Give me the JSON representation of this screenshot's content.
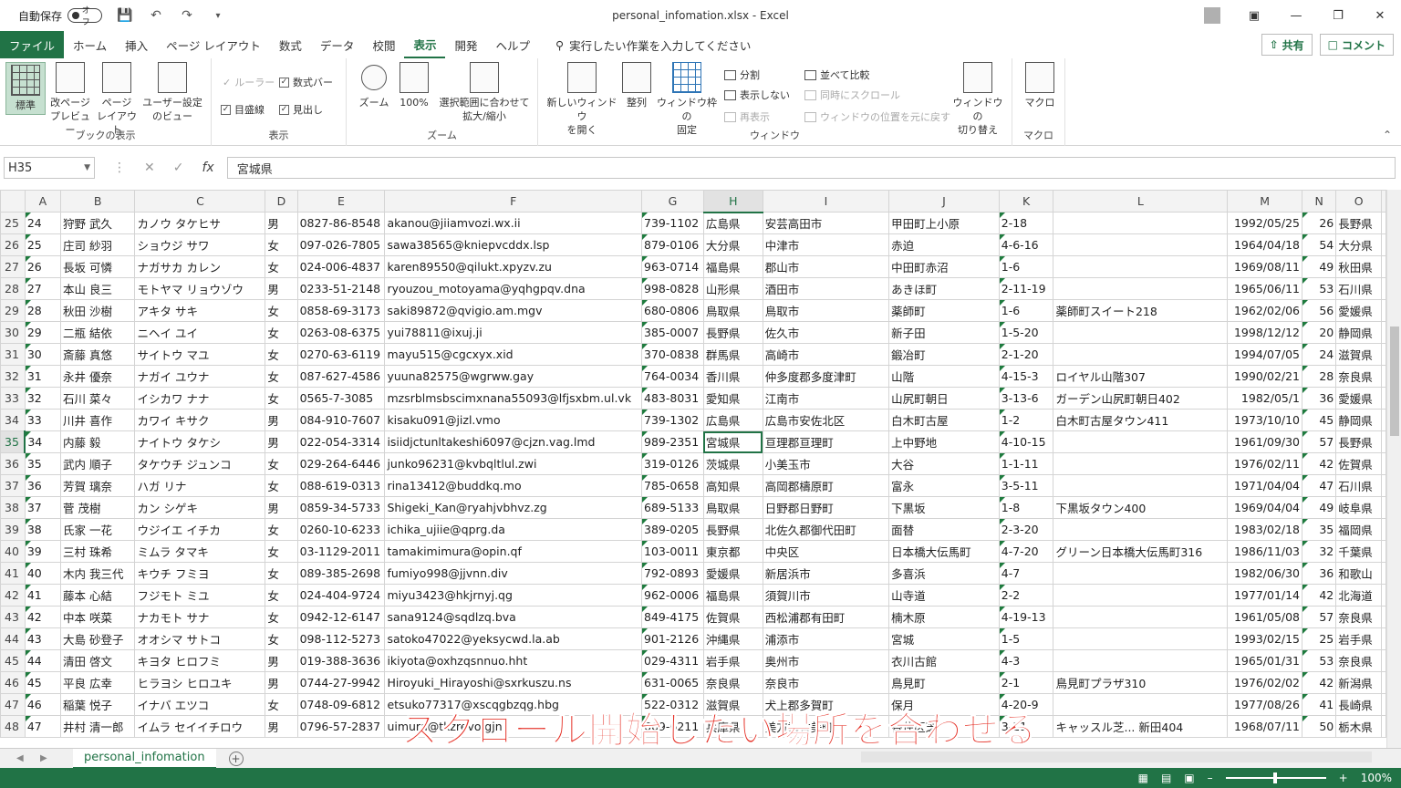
{
  "title_bar": {
    "autosave_label": "自動保存",
    "autosave_state": "オフ",
    "document_title": "personal_infomation.xlsx  -  Excel"
  },
  "menu": {
    "file": "ファイル",
    "tabs": [
      "ホーム",
      "挿入",
      "ページ レイアウト",
      "数式",
      "データ",
      "校閲",
      "表示",
      "開発",
      "ヘルプ"
    ],
    "active_tab": "表示",
    "tell_me": "実行したい作業を入力してください",
    "share": "共有",
    "comment": "コメント"
  },
  "ribbon": {
    "workbook_views": {
      "label": "ブックの表示",
      "normal": "標準",
      "page_break": "改ページ\nプレビュー",
      "page_layout": "ページ\nレイアウト",
      "custom": "ユーザー設定\nのビュー"
    },
    "show": {
      "label": "表示",
      "ruler": "ルーラー",
      "formula_bar": "数式バー",
      "gridlines": "目盛線",
      "headings": "見出し"
    },
    "zoom": {
      "label": "ズーム",
      "zoom": "ズーム",
      "hundred": "100%",
      "fit": "選択範囲に合わせて\n拡大/縮小"
    },
    "window": {
      "label": "ウィンドウ",
      "new_window": "新しいウィンドウ\nを開く",
      "arrange": "整列",
      "freeze": "ウィンドウ枠の\n固定",
      "split": "分割",
      "hide": "表示しない",
      "unhide": "再表示",
      "side_by_side": "並べて比較",
      "sync_scroll": "同時にスクロール",
      "reset_pos": "ウィンドウの位置を元に戻す",
      "switch": "ウィンドウの\n切り替え"
    },
    "macro": {
      "label": "マクロ",
      "macro": "マクロ"
    }
  },
  "formula_bar": {
    "name_box": "H35",
    "fx": "fx",
    "content": "宮城県"
  },
  "columns": [
    "A",
    "B",
    "C",
    "D",
    "E",
    "F",
    "G",
    "H",
    "I",
    "J",
    "K",
    "L",
    "M",
    "N",
    "O"
  ],
  "active_column": "H",
  "active_row": "35",
  "rows": [
    {
      "r": "25",
      "c": [
        "24",
        "狩野 武久",
        "カノウ タケヒサ",
        "男",
        "0827-86-8548",
        "akanou@jiiamvozi.wx.ii",
        "739-1102",
        "広島県",
        "安芸高田市",
        "甲田町上小原",
        "2-18",
        "",
        "1992/05/25",
        "26",
        "長野県"
      ]
    },
    {
      "r": "26",
      "c": [
        "25",
        "庄司 紗羽",
        "ショウジ サワ",
        "女",
        "097-026-7805",
        "sawa38565@kniepvcddx.lsp",
        "879-0106",
        "大分県",
        "中津市",
        "赤迫",
        "4-6-16",
        "",
        "1964/04/18",
        "54",
        "大分県"
      ]
    },
    {
      "r": "27",
      "c": [
        "26",
        "長坂 可憐",
        "ナガサカ カレン",
        "女",
        "024-006-4837",
        "karen89550@qilukt.xpyzv.zu",
        "963-0714",
        "福島県",
        "郡山市",
        "中田町赤沼",
        "1-6",
        "",
        "1969/08/11",
        "49",
        "秋田県"
      ]
    },
    {
      "r": "28",
      "c": [
        "27",
        "本山 良三",
        "モトヤマ リョウゾウ",
        "男",
        "0233-51-2148",
        "ryouzou_motoyama@yqhgpqv.dna",
        "998-0828",
        "山形県",
        "酒田市",
        "あきほ町",
        "2-11-19",
        "",
        "1965/06/11",
        "53",
        "石川県"
      ]
    },
    {
      "r": "29",
      "c": [
        "28",
        "秋田 沙樹",
        "アキタ サキ",
        "女",
        "0858-69-3173",
        "saki89872@qvigio.am.mgv",
        "680-0806",
        "鳥取県",
        "鳥取市",
        "薬師町",
        "1-6",
        "薬師町スイート218",
        "1962/02/06",
        "56",
        "愛媛県"
      ]
    },
    {
      "r": "30",
      "c": [
        "29",
        "二瓶 結依",
        "ニヘイ ユイ",
        "女",
        "0263-08-6375",
        "yui78811@ixuj.ji",
        "385-0007",
        "長野県",
        "佐久市",
        "新子田",
        "1-5-20",
        "",
        "1998/12/12",
        "20",
        "静岡県"
      ]
    },
    {
      "r": "31",
      "c": [
        "30",
        "斎藤 真悠",
        "サイトウ マユ",
        "女",
        "0270-63-6119",
        "mayu515@cgcxyx.xid",
        "370-0838",
        "群馬県",
        "高崎市",
        "鍛冶町",
        "2-1-20",
        "",
        "1994/07/05",
        "24",
        "滋賀県"
      ]
    },
    {
      "r": "32",
      "c": [
        "31",
        "永井 優奈",
        "ナガイ ユウナ",
        "女",
        "087-627-4586",
        "yuuna82575@wgrww.gay",
        "764-0034",
        "香川県",
        "仲多度郡多度津町",
        "山階",
        "4-15-3",
        "ロイヤル山階307",
        "1990/02/21",
        "28",
        "奈良県"
      ]
    },
    {
      "r": "33",
      "c": [
        "32",
        "石川 菜々",
        "イシカワ ナナ",
        "女",
        "0565-7-3085",
        "mzsrblmsbscimxnana55093@lfjsxbm.ul.vk",
        "483-8031",
        "愛知県",
        "江南市",
        "山尻町朝日",
        "3-13-6",
        "ガーデン山尻町朝日402",
        "1982/05/1",
        "36",
        "愛媛県"
      ]
    },
    {
      "r": "34",
      "c": [
        "33",
        "川井 喜作",
        "カワイ キサク",
        "男",
        "084-910-7607",
        "kisaku091@jizl.vmo",
        "739-1302",
        "広島県",
        "広島市安佐北区",
        "白木町古屋",
        "1-2",
        "白木町古屋タウン411",
        "1973/10/10",
        "45",
        "静岡県"
      ]
    },
    {
      "r": "35",
      "c": [
        "34",
        "内藤 毅",
        "ナイトウ タケシ",
        "男",
        "022-054-3314",
        "isiidjctunltakeshi6097@cjzn.vag.lmd",
        "989-2351",
        "宮城県",
        "亘理郡亘理町",
        "上中野地",
        "4-10-15",
        "",
        "1961/09/30",
        "57",
        "長野県"
      ]
    },
    {
      "r": "36",
      "c": [
        "35",
        "武内 順子",
        "タケウチ ジュンコ",
        "女",
        "029-264-6446",
        "junko96231@kvbqltlul.zwi",
        "319-0126",
        "茨城県",
        "小美玉市",
        "大谷",
        "1-1-11",
        "",
        "1976/02/11",
        "42",
        "佐賀県"
      ]
    },
    {
      "r": "37",
      "c": [
        "36",
        "芳賀 璃奈",
        "ハガ リナ",
        "女",
        "088-619-0313",
        "rina13412@buddkq.mo",
        "785-0658",
        "高知県",
        "高岡郡檮原町",
        "富永",
        "3-5-11",
        "",
        "1971/04/04",
        "47",
        "石川県"
      ]
    },
    {
      "r": "38",
      "c": [
        "37",
        "菅 茂樹",
        "カン シゲキ",
        "男",
        "0859-34-5733",
        "Shigeki_Kan@ryahjvbhvz.zg",
        "689-5133",
        "鳥取県",
        "日野郡日野町",
        "下黒坂",
        "1-8",
        "下黒坂タウン400",
        "1969/04/04",
        "49",
        "岐阜県"
      ]
    },
    {
      "r": "39",
      "c": [
        "38",
        "氏家 一花",
        "ウジイエ イチカ",
        "女",
        "0260-10-6233",
        "ichika_ujiie@qprg.da",
        "389-0205",
        "長野県",
        "北佐久郡御代田町",
        "面替",
        "2-3-20",
        "",
        "1983/02/18",
        "35",
        "福岡県"
      ]
    },
    {
      "r": "40",
      "c": [
        "39",
        "三村 珠希",
        "ミムラ タマキ",
        "女",
        "03-1129-2011",
        "tamakimimura@opin.qf",
        "103-0011",
        "東京都",
        "中央区",
        "日本橋大伝馬町",
        "4-7-20",
        "グリーン日本橋大伝馬町316",
        "1986/11/03",
        "32",
        "千葉県"
      ]
    },
    {
      "r": "41",
      "c": [
        "40",
        "木内 我三代",
        "キウチ フミヨ",
        "女",
        "089-385-2698",
        "fumiyo998@jjvnn.div",
        "792-0893",
        "愛媛県",
        "新居浜市",
        "多喜浜",
        "4-7",
        "",
        "1982/06/30",
        "36",
        "和歌山"
      ]
    },
    {
      "r": "42",
      "c": [
        "41",
        "藤本 心結",
        "フジモト ミユ",
        "女",
        "024-404-9724",
        "miyu3423@hkjrnyj.qg",
        "962-0006",
        "福島県",
        "須賀川市",
        "山寺道",
        "2-2",
        "",
        "1977/01/14",
        "42",
        "北海道"
      ]
    },
    {
      "r": "43",
      "c": [
        "42",
        "中本 咲菜",
        "ナカモト サナ",
        "女",
        "0942-12-6147",
        "sana9124@sqdlzq.bva",
        "849-4175",
        "佐賀県",
        "西松浦郡有田町",
        "楠木原",
        "4-19-13",
        "",
        "1961/05/08",
        "57",
        "奈良県"
      ]
    },
    {
      "r": "44",
      "c": [
        "43",
        "大島 砂登子",
        "オオシマ サトコ",
        "女",
        "098-112-5273",
        "satoko47022@yeksycwd.la.ab",
        "901-2126",
        "沖縄県",
        "浦添市",
        "宮城",
        "1-5",
        "",
        "1993/02/15",
        "25",
        "岩手県"
      ]
    },
    {
      "r": "45",
      "c": [
        "44",
        "清田 啓文",
        "キヨタ ヒロフミ",
        "男",
        "019-388-3636",
        "ikiyota@oxhzqsnnuo.hht",
        "029-4311",
        "岩手県",
        "奥州市",
        "衣川古館",
        "4-3",
        "",
        "1965/01/31",
        "53",
        "奈良県"
      ]
    },
    {
      "r": "46",
      "c": [
        "45",
        "平良 広幸",
        "ヒラヨシ ヒロユキ",
        "男",
        "0744-27-9942",
        "Hiroyuki_Hirayoshi@sxrkuszu.ns",
        "631-0065",
        "奈良県",
        "奈良市",
        "鳥見町",
        "2-1",
        "鳥見町プラザ310",
        "1976/02/02",
        "42",
        "新潟県"
      ]
    },
    {
      "r": "47",
      "c": [
        "46",
        "稲葉 悦子",
        "イナバ エツコ",
        "女",
        "0748-09-6812",
        "etsuko77317@xscqgbzqg.hbg",
        "522-0312",
        "滋賀県",
        "犬上郡多賀町",
        "保月",
        "4-20-9",
        "",
        "1977/08/26",
        "41",
        "長崎県"
      ]
    },
    {
      "r": "48",
      "c": [
        "47",
        "井村 清一郎",
        "イムラ セイイチロウ",
        "男",
        "0796-57-2837",
        "uimura@tkzrevo.gjn",
        "669-6211",
        "兵庫県",
        "美方郡香美町",
        "香住区芝",
        "3-11",
        "キャッスル芝... 新田404",
        "1968/07/11",
        "50",
        "栃木県"
      ]
    }
  ],
  "sheet_tab": "personal_infomation",
  "zoom_level": "100%",
  "caption": "スクロール開始したい場所を合わせる"
}
